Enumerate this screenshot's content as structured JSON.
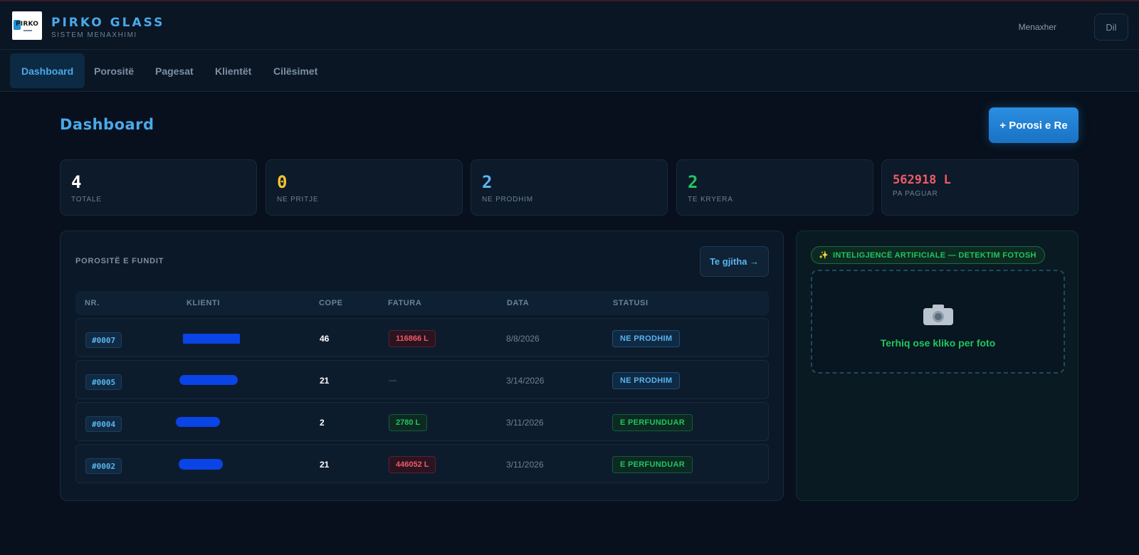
{
  "app": {
    "brand_title": "PIRKO GLASS",
    "brand_subtitle": "SISTEM MENAXHIMI",
    "logo_text": "PIRKO",
    "role": "Menaxher",
    "lang_button": "Dil"
  },
  "nav": {
    "tabs": [
      {
        "label": "Dashboard",
        "active": true
      },
      {
        "label": "Porositë",
        "active": false
      },
      {
        "label": "Pagesat",
        "active": false
      },
      {
        "label": "Klientët",
        "active": false
      },
      {
        "label": "Cilësimet",
        "active": false
      }
    ]
  },
  "page": {
    "title": "Dashboard",
    "new_order_button": "+ Porosi e Re"
  },
  "stats": [
    {
      "value": "4",
      "label": "TOTALE",
      "color": "#ffffff"
    },
    {
      "value": "0",
      "label": "NE PRITJE",
      "color": "#f2c230"
    },
    {
      "value": "2",
      "label": "NE PRODHIM",
      "color": "#5bb4f0"
    },
    {
      "value": "2",
      "label": "TE KRYERA",
      "color": "#22c55e"
    },
    {
      "value": "562918  L",
      "label": "PA PAGUAR",
      "color": "#f05a66"
    }
  ],
  "orders": {
    "title": "POROSITË E FUNDIT",
    "view_all_button": "Te gjitha →",
    "columns": [
      "NR.",
      "KLIENTI",
      "COPE",
      "FATURA",
      "DATA",
      "STATUSI"
    ],
    "rows": [
      {
        "id": "#0007",
        "qty": "46",
        "invoice": "116866 L",
        "invoice_state": "unpaid",
        "date": "8/8/2026",
        "status": "NE PRODHIM",
        "status_type": "production"
      },
      {
        "id": "#0005",
        "qty": "21",
        "invoice": "—",
        "invoice_state": "none",
        "date": "3/14/2026",
        "status": "NE PRODHIM",
        "status_type": "production"
      },
      {
        "id": "#0004",
        "qty": "2",
        "invoice": "2780 L",
        "invoice_state": "paid",
        "date": "3/11/2026",
        "status": "E PERFUNDUAR",
        "status_type": "done"
      },
      {
        "id": "#0002",
        "qty": "21",
        "invoice": "446052 L",
        "invoice_state": "unpaid",
        "date": "3/11/2026",
        "status": "E PERFUNDUAR",
        "status_type": "done"
      }
    ]
  },
  "ai": {
    "badge_icon": "sparkles-icon",
    "badge_label": "INTELIGJENCË ARTIFICIALE — DETEKTIM FOTOSH",
    "dropzone_icon": "camera-icon",
    "dropzone_text": "Terhiq ose kliko per foto"
  }
}
